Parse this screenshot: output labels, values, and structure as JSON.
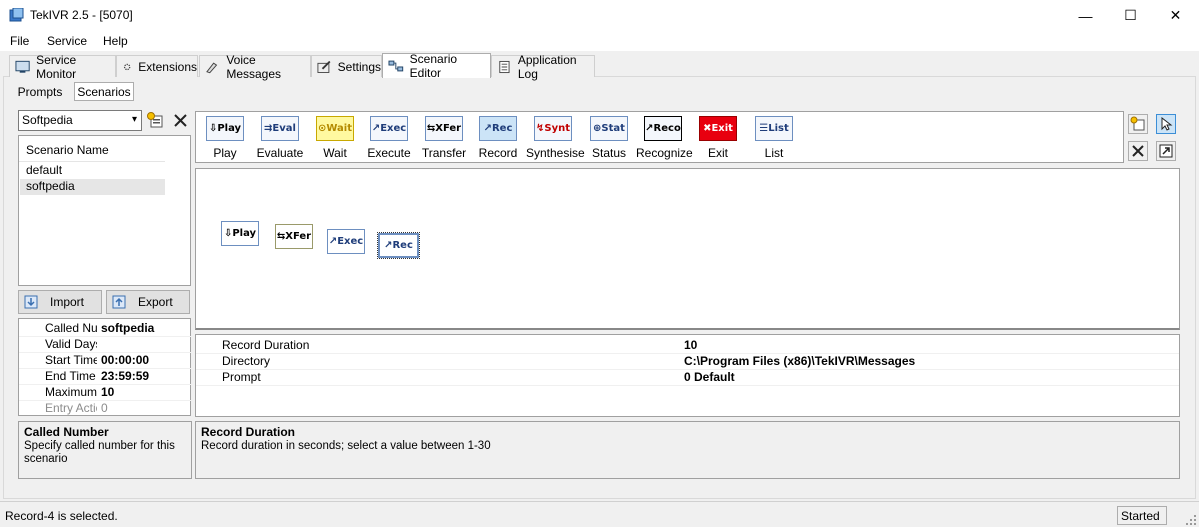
{
  "window": {
    "title": "TekIVR 2.5 - [5070]",
    "minimize": "—",
    "maximize": "☐",
    "close": "✕"
  },
  "menu": [
    "File",
    "Service",
    "Help"
  ],
  "tabs": [
    {
      "label": "Service Monitor",
      "icon": "monitor-icon"
    },
    {
      "label": "Extensions",
      "icon": "extensions-icon"
    },
    {
      "label": "Voice Messages",
      "icon": "voice-messages-icon"
    },
    {
      "label": "Settings",
      "icon": "settings-icon"
    },
    {
      "label": "Scenario Editor",
      "icon": "scenario-editor-icon",
      "active": true
    },
    {
      "label": "Application Log",
      "icon": "log-icon"
    }
  ],
  "subtabs": [
    "Prompts",
    "Scenarios"
  ],
  "scenario_combo": {
    "value": "Softpedia"
  },
  "scenario_list": {
    "header": "Scenario Name",
    "items": [
      "default",
      "softpedia"
    ],
    "selected": "softpedia"
  },
  "buttons": {
    "import": "Import",
    "export": "Export"
  },
  "scenario_props": [
    {
      "name": "Called Number",
      "value": "softpedia"
    },
    {
      "name": "Valid Days",
      "value": ""
    },
    {
      "name": "Start Time",
      "value": "00:00:00"
    },
    {
      "name": "End Time",
      "value": "23:59:59"
    },
    {
      "name": "Maximum #",
      "value": "10"
    },
    {
      "name": "Entry Action",
      "value": "0",
      "disabled": true
    }
  ],
  "left_desc": {
    "title": "Called Number",
    "text": "Specify called number for this scenario"
  },
  "toolbox": [
    {
      "icon": "⇩Play",
      "label": "Play",
      "color": "#000"
    },
    {
      "icon": "⇉Eval",
      "label": "Evaluate",
      "color": "#1f3d7a"
    },
    {
      "icon": "⊙Wait",
      "label": "Wait",
      "color": "#b48a00"
    },
    {
      "icon": "↗Exec",
      "label": "Execute",
      "color": "#1f3d7a"
    },
    {
      "icon": "⇆XFer",
      "label": "Transfer",
      "color": "#000"
    },
    {
      "icon": "↗Rec",
      "label": "Record",
      "color": "#1f3d7a"
    },
    {
      "icon": "↯Synt",
      "label": "Synthesise",
      "color": "#c00000"
    },
    {
      "icon": "⊕Stat",
      "label": "Status",
      "color": "#1f3d7a"
    },
    {
      "icon": "↗Reco",
      "label": "Recognize",
      "color": "#000"
    },
    {
      "icon": "✖Exit",
      "label": "Exit",
      "color": "#fff"
    },
    {
      "icon": "☰List",
      "label": "List",
      "color": "#1f3d7a"
    }
  ],
  "canvas_nodes": [
    "⇩Play",
    "⇆XFer",
    "↗Exec",
    "↗Rec"
  ],
  "record_props": [
    {
      "name": "Record Duration",
      "value": "10"
    },
    {
      "name": "Directory",
      "value": "C:\\Program Files (x86)\\TekIVR\\Messages"
    },
    {
      "name": "Prompt",
      "value": "0 Default"
    }
  ],
  "right_desc": {
    "title": "Record Duration",
    "text": "Record duration in seconds; select a value between 1-30"
  },
  "status": {
    "text": "Record-4 is selected.",
    "state": "Started"
  }
}
